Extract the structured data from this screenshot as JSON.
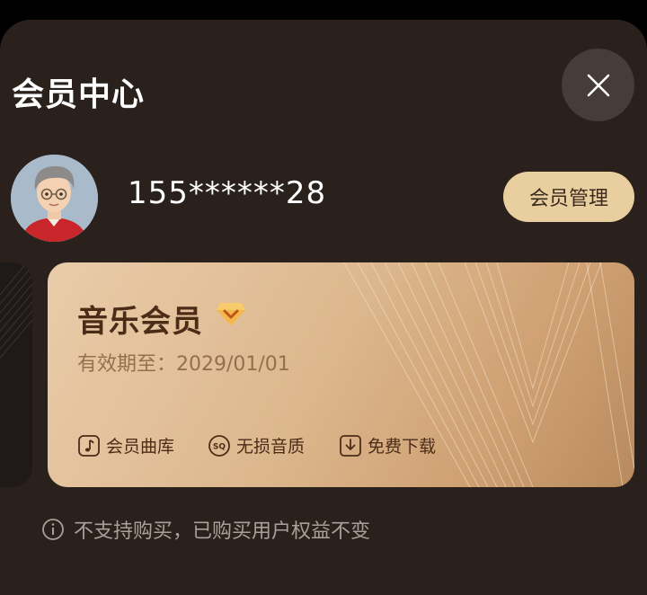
{
  "header": {
    "title": "会员中心"
  },
  "user": {
    "name": "155******28",
    "manage_label": "会员管理"
  },
  "card": {
    "name": "音乐会员",
    "validity": "有效期至：2029/01/01",
    "perks": [
      {
        "label": "会员曲库",
        "icon": "music-note-icon"
      },
      {
        "label": "无损音质",
        "icon": "sq-icon"
      },
      {
        "label": "免费下载",
        "icon": "download-icon"
      }
    ]
  },
  "notice": {
    "text": "不支持购买，已购买用户权益不变",
    "icon": "info-icon"
  },
  "colors": {
    "background": "#2b211c",
    "accent": "#e9cfa0",
    "card_gold": "#ddb88f",
    "card_text": "#4b2c17"
  }
}
